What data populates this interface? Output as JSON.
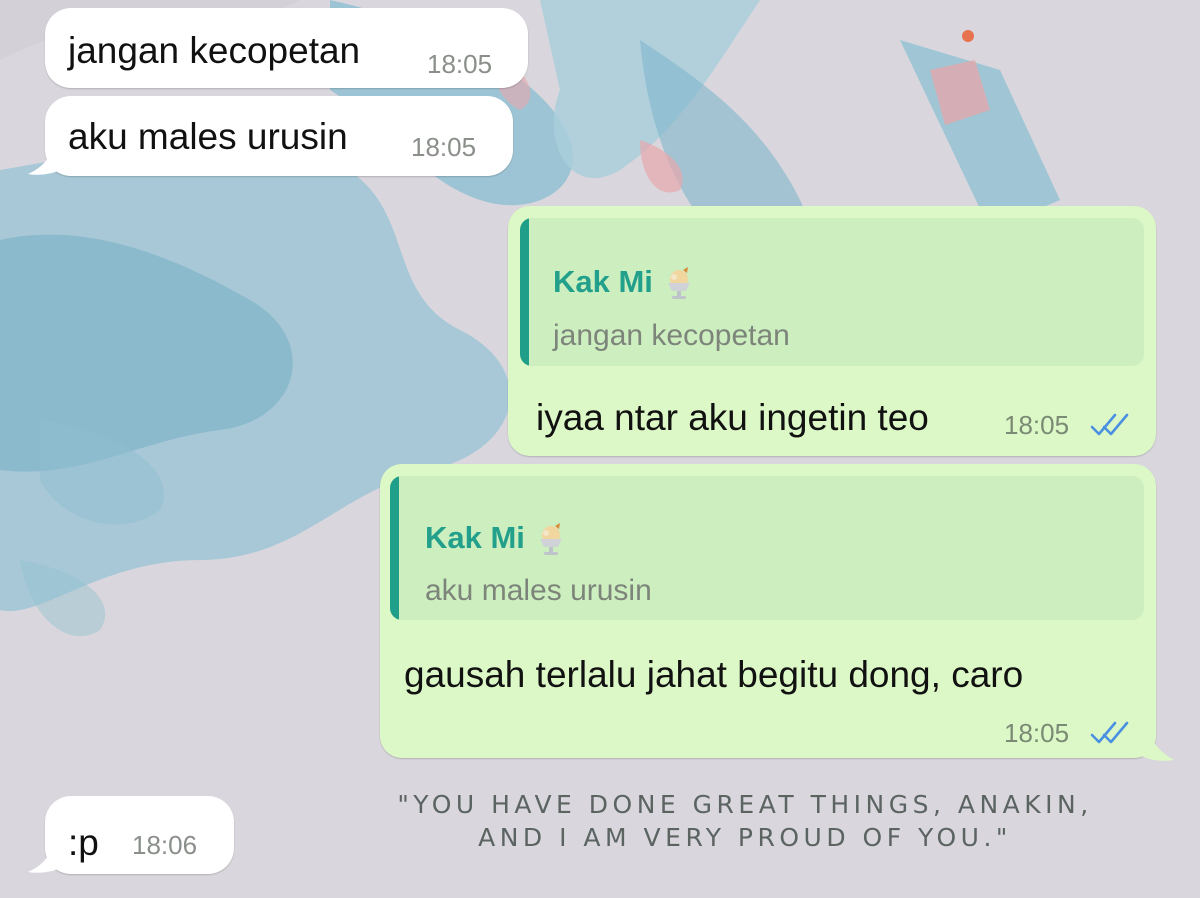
{
  "messages": [
    {
      "direction": "incoming",
      "text": "jangan kecopetan",
      "time": "18:05"
    },
    {
      "direction": "incoming",
      "text": "aku males urusin",
      "time": "18:05"
    },
    {
      "direction": "outgoing",
      "reply_to": {
        "sender": "Kak Mi",
        "sender_icon": "ice-cream-sundae-emoji",
        "text": "jangan kecopetan"
      },
      "text": "iyaa ntar aku ingetin teo",
      "time": "18:05",
      "status": "read"
    },
    {
      "direction": "outgoing",
      "reply_to": {
        "sender": "Kak Mi",
        "sender_icon": "ice-cream-sundae-emoji",
        "text": "aku males urusin"
      },
      "text": "gausah terlalu jahat begitu dong, caro",
      "time": "18:05",
      "status": "read"
    },
    {
      "direction": "incoming",
      "text": ":p",
      "time": "18:06"
    }
  ],
  "wallpaper": {
    "quote_line1": "\"YOU HAVE DONE GREAT THINGS, ANAKIN,",
    "quote_line2": "AND I AM VERY PROUD OF YOU.\""
  },
  "colors": {
    "incoming_bubble": "#ffffff",
    "outgoing_bubble": "#dcf8c6",
    "quote_accent": "#1f9e8a",
    "read_ticks": "#4a90e2"
  }
}
